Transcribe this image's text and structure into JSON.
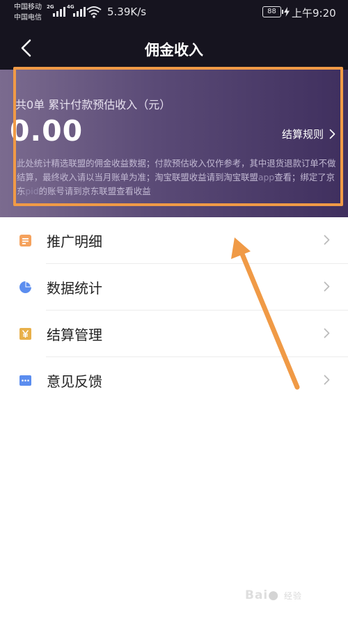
{
  "status_bar": {
    "carrier_1": "中国移动",
    "carrier_2": "中国电信",
    "net_1": "2G",
    "net_2": "4G",
    "speed": "5.39K/s",
    "battery": "88",
    "time": "上午9:20"
  },
  "header": {
    "title": "佣金收入",
    "back_icon": "chevron-left-icon"
  },
  "earnings": {
    "caption": "共0单 累计付款预估收入（元）",
    "amount": "0.00",
    "rules_label": "结算规则",
    "note_part_1": "此处统计精选联盟的佣金收益数据；付款预估收入仅作参考，其中退货退款订单不做结算，最终收入请以当月账单为准；淘宝联盟收益请到淘宝联盟",
    "note_app": "app",
    "note_part_2": "查看；绑定了京东",
    "note_pid": "pid",
    "note_part_3": "的账号请到京东联盟查看收益"
  },
  "menu": {
    "items": [
      {
        "label": "推广明细",
        "icon": "document-icon",
        "color": "#f5a25d"
      },
      {
        "label": "数据统计",
        "icon": "pie-chart-icon",
        "color": "#5b8def"
      },
      {
        "label": "结算管理",
        "icon": "yen-icon",
        "color": "#e8b04a"
      },
      {
        "label": "意见反馈",
        "icon": "chat-bubble-icon",
        "color": "#5b8def"
      }
    ]
  },
  "watermark": {
    "text": "Bai",
    "suffix": "经验"
  },
  "colors": {
    "header_bg": "#16141f",
    "card_gradient_start": "#7b6b8f",
    "card_gradient_end": "#3f2f5e",
    "annotation": "#f09a46"
  }
}
